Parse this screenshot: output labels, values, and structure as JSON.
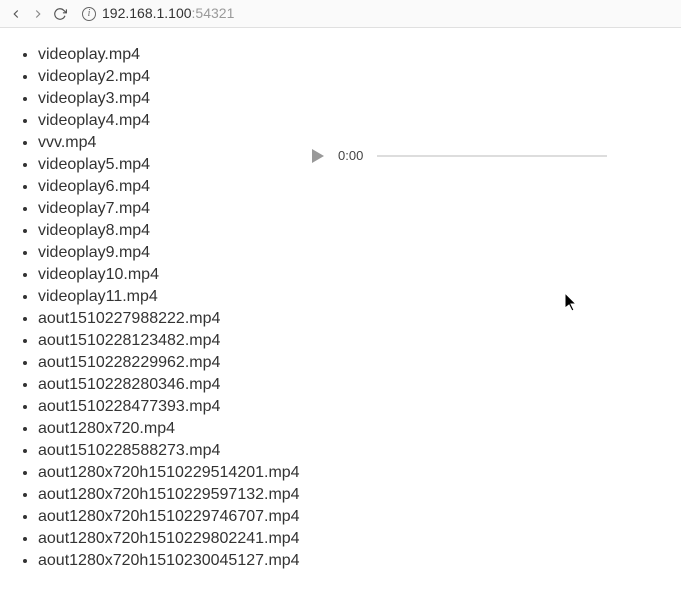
{
  "toolbar": {
    "address_host": "192.168.1.100",
    "address_port": ":54321"
  },
  "files": [
    "videoplay.mp4",
    "videoplay2.mp4",
    "videoplay3.mp4",
    "videoplay4.mp4",
    "vvv.mp4",
    "videoplay5.mp4",
    "videoplay6.mp4",
    "videoplay7.mp4",
    "videoplay8.mp4",
    "videoplay9.mp4",
    "videoplay10.mp4",
    "videoplay11.mp4",
    "aout1510227988222.mp4",
    "aout1510228123482.mp4",
    "aout1510228229962.mp4",
    "aout1510228280346.mp4",
    "aout1510228477393.mp4",
    "aout1280x720.mp4",
    "aout1510228588273.mp4",
    "aout1280x720h1510229514201.mp4",
    "aout1280x720h1510229597132.mp4",
    "aout1280x720h1510229746707.mp4",
    "aout1280x720h1510229802241.mp4",
    "aout1280x720h1510230045127.mp4"
  ],
  "player": {
    "time": "0:00"
  }
}
